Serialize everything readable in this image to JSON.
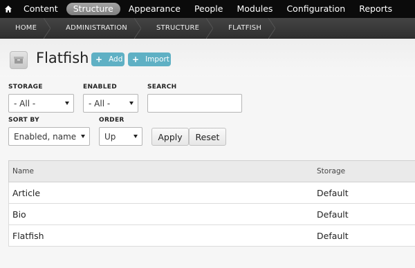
{
  "toolbar": {
    "items": [
      {
        "label": "Content"
      },
      {
        "label": "Structure",
        "active": true
      },
      {
        "label": "Appearance"
      },
      {
        "label": "People"
      },
      {
        "label": "Modules"
      },
      {
        "label": "Configuration"
      },
      {
        "label": "Reports"
      }
    ]
  },
  "breadcrumb": [
    "HOME",
    "ADMINISTRATION",
    "STRUCTURE",
    "FLATFISH"
  ],
  "page": {
    "title": "Flatfish",
    "add_label": "Add",
    "import_label": "Import"
  },
  "filters": {
    "storage_label": "STORAGE",
    "storage_value": "- All -",
    "enabled_label": "ENABLED",
    "enabled_value": "- All -",
    "search_label": "SEARCH",
    "search_value": "",
    "sortby_label": "SORT BY",
    "sortby_value": "Enabled, name",
    "order_label": "ORDER",
    "order_value": "Up",
    "apply_label": "Apply",
    "reset_label": "Reset"
  },
  "table": {
    "headers": {
      "name": "Name",
      "storage": "Storage"
    },
    "rows": [
      {
        "name": "Article",
        "storage": "Default"
      },
      {
        "name": "Bio",
        "storage": "Default"
      },
      {
        "name": "Flatfish",
        "storage": "Default"
      }
    ]
  },
  "colors": {
    "toolbar_bg": "#0b0b0b",
    "action_button": "#5fb0c4"
  }
}
